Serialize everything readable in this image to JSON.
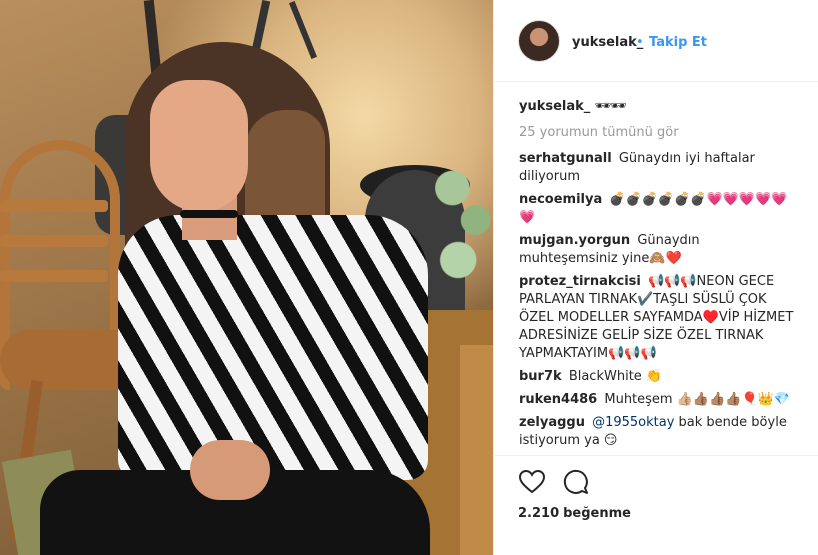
{
  "header": {
    "username": "yukselak_",
    "separator": "•",
    "follow_label": "Takip Et"
  },
  "caption": {
    "username": "yukselak_",
    "text": "🕶🕶"
  },
  "view_all_label": "25 yorumun tümünü gör",
  "comments": [
    {
      "user": "serhatgunall",
      "text": "Günaydın iyi haftalar diliyorum"
    },
    {
      "user": "necoemilya",
      "text": "💣💣💣💣💣💣💗💗💗💗💗💗"
    },
    {
      "user": "mujgan.yorgun",
      "text": "Günaydın muhteşemsiniz yine🙈❤️"
    },
    {
      "user": "protez_tirnakcisi",
      "text": "📢📢📢NEON GECE PARLAYAN TIRNAK✔️TAŞLI SÜSLÜ ÇOK ÖZEL MODELLER SAYFAMDA♥️VİP HİZMET ADRESİNİZE GELİP SİZE ÖZEL TIRNAK YAPMAKTAYIM📢📢📢"
    },
    {
      "user": "bur7k",
      "text": "BlackWhite 👏"
    },
    {
      "user": "ruken4486",
      "text": "Muhteşem 👍🏼👍🏽👍🏽👍🏽🎈👑💎"
    },
    {
      "user": "zelyaggu",
      "mention": "@1955oktay",
      "text": " bak bende böyle istiyorum ya 😏"
    }
  ],
  "likes": {
    "count": "2.210",
    "label": "beğenme"
  },
  "icons": {
    "heart": "heart-icon",
    "comment": "comment-icon"
  },
  "colors": {
    "link_blue": "#3897f0",
    "text": "#262626",
    "muted": "#999999",
    "mention": "#003569"
  }
}
